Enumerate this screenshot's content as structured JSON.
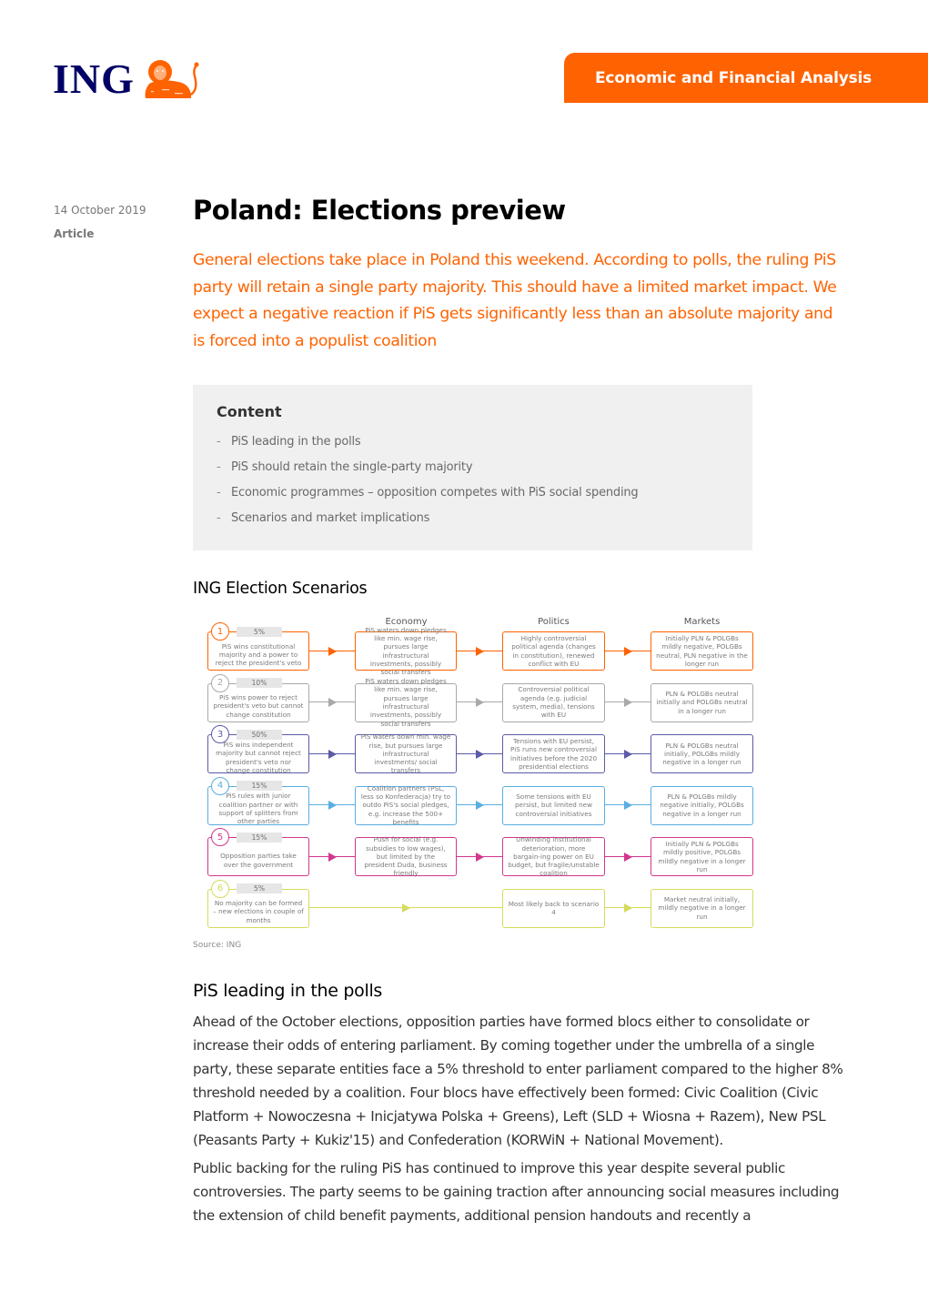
{
  "logo": {
    "text": "ING",
    "icon": "lion-icon",
    "color": "#000066",
    "lion_color": "#FF6200"
  },
  "header": {
    "section_label": "Economic and Financial Analysis",
    "accent": "#FF6200"
  },
  "meta": {
    "date": "14 October 2019",
    "type": "Article"
  },
  "title": "Poland: Elections preview",
  "lead": "General elections take place in Poland this weekend. According to polls, the ruling PiS party will retain a single party majority. This should have a limited market impact. We expect a negative reaction if PiS gets significantly less than an absolute majority and is forced into a populist coalition",
  "toc": {
    "title": "Content",
    "items": [
      "PiS leading in the polls",
      "PiS should retain the single-party majority",
      "Economic programmes – opposition competes with PiS social spending",
      "Scenarios and market implications"
    ]
  },
  "figure": {
    "title": "ING Election Scenarios",
    "source": "Source: ING",
    "columns": [
      "Economy",
      "Politics",
      "Markets"
    ],
    "scenarios": [
      {
        "number": "1",
        "probability": "5%",
        "color": "#FF6200",
        "scenario": "PiS wins constitutional majority and a power to reject the president's veto",
        "economy": "PiS waters down pledges like min. wage rise, pursues large infrastructural investments, possibly social transfers",
        "politics": "Highly controversial political agenda (changes in constitution), renewed conflict with EU",
        "markets": "Initially PLN & POLGBs mildly negative, POLGBs neutral, PLN negative in the longer run"
      },
      {
        "number": "2",
        "probability": "10%",
        "color": "#A9A9A9",
        "scenario": "PiS wins power to reject president's veto but cannot change constitution",
        "economy": "PiS waters down pledges like min. wage rise, pursues large infrastructural investments, possibly social transfers",
        "politics": "Controversial political agenda (e.g. judicial system, media), tensions with EU",
        "markets": "PLN & POLGBs neutral initially and POLGBs neutral in a longer run"
      },
      {
        "number": "3",
        "probability": "50%",
        "color": "#5B5BA8",
        "scenario": "PiS wins independent majority but cannot reject president's veto nor change constitution",
        "economy": "PiS waters down min. wage rise, but pursues large infrastructural investments/ social transfers",
        "politics": "Tensions with EU persist, PiS runs new controversial initiatives before the 2020 presidential elections",
        "markets": "PLN & POLGBs neutral initially, POLGBs mildly negative in a longer run"
      },
      {
        "number": "4",
        "probability": "15%",
        "color": "#5AAEE2",
        "scenario": "PiS rules with junior coalition partner or with support of splitters from other parties",
        "economy": "Coalition partners (PSL, less so Konfederacja) try to outdo PiS's social pledges, e.g. increase the 500+ benefits",
        "politics": "Some tensions with EU persist, but limited new controversial initiatives",
        "markets": "PLN & POLGBs mildly negative initially, POLGBs negative in a longer run"
      },
      {
        "number": "5",
        "probability": "15%",
        "color": "#D2378C",
        "scenario": "Opposition parties take over the government",
        "economy": "Push for social (e.g. subsidies to low wages), but limited by the president Duda, business friendly",
        "politics": "Unwinding institutional deterioration, more bargain-ing power on EU budget, but fragile/unstable coalition",
        "markets": "Initially PLN & POLGBs mildly positive, POLGBs mildly negative in a longer run"
      },
      {
        "number": "6",
        "probability": "5%",
        "color": "#D5DB5C",
        "scenario": "No majority can be formed – new elections in couple of months",
        "economy": null,
        "politics": "Most likely back to scenario 4",
        "markets": "Market neutral initially, mildly negative in a longer run"
      }
    ]
  },
  "section1": {
    "heading": "PiS leading in the polls",
    "paragraphs": [
      "Ahead of the October elections, opposition parties have formed blocs either to consolidate or increase their odds of entering parliament. By coming together under the umbrella of a single party, these separate entities face a 5% threshold to enter parliament compared to the higher 8% threshold needed by a coalition. Four blocs have effectively been formed: Civic Coalition (Civic Platform + Nowoczesna + Inicjatywa Polska + Greens), Left (SLD + Wiosna + Razem), New PSL (Peasants Party +  Kukiz'15) and Confederation (KORWiN + National Movement).",
      "Public backing for the ruling PiS has continued to improve this year despite several public controversies. The party seems to be gaining traction after announcing social measures including the extension of child benefit payments, additional pension handouts and recently a"
    ]
  }
}
